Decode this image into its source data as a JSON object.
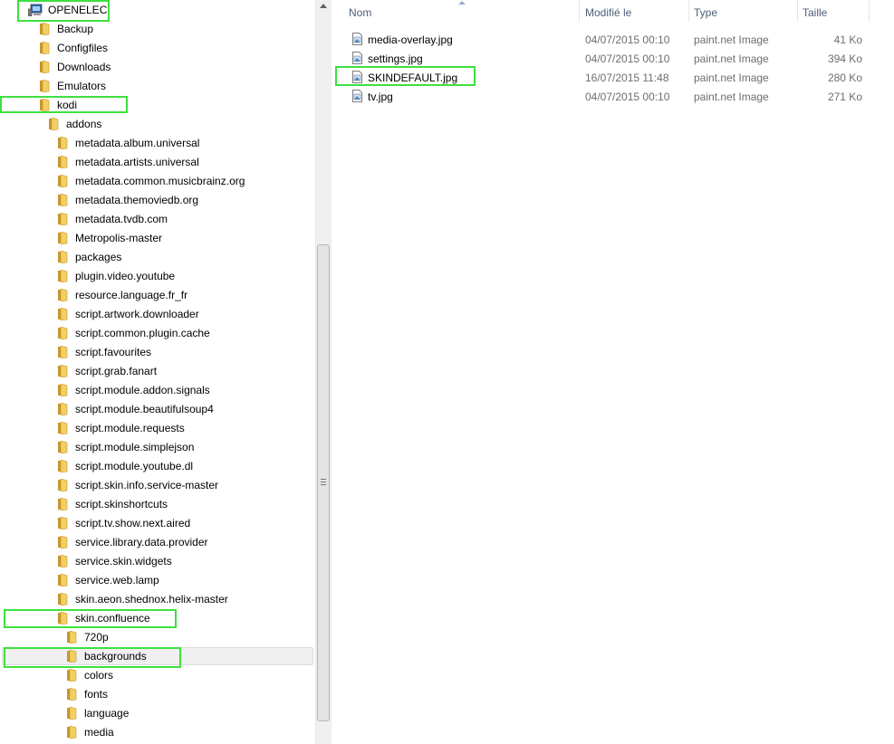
{
  "tree": {
    "items": [
      {
        "label": "OPENELEC",
        "icon": "computer-icon"
      },
      {
        "label": "Backup",
        "icon": "folder-icon"
      },
      {
        "label": "Configfiles",
        "icon": "folder-icon"
      },
      {
        "label": "Downloads",
        "icon": "folder-icon"
      },
      {
        "label": "Emulators",
        "icon": "folder-icon"
      },
      {
        "label": "kodi",
        "icon": "folder-icon"
      },
      {
        "label": "addons",
        "icon": "folder-icon"
      },
      {
        "label": "metadata.album.universal",
        "icon": "folder-icon"
      },
      {
        "label": "metadata.artists.universal",
        "icon": "folder-icon"
      },
      {
        "label": "metadata.common.musicbrainz.org",
        "icon": "folder-icon"
      },
      {
        "label": "metadata.themoviedb.org",
        "icon": "folder-icon"
      },
      {
        "label": "metadata.tvdb.com",
        "icon": "folder-icon"
      },
      {
        "label": "Metropolis-master",
        "icon": "folder-icon"
      },
      {
        "label": "packages",
        "icon": "folder-icon"
      },
      {
        "label": "plugin.video.youtube",
        "icon": "folder-icon"
      },
      {
        "label": "resource.language.fr_fr",
        "icon": "folder-icon"
      },
      {
        "label": "script.artwork.downloader",
        "icon": "folder-icon"
      },
      {
        "label": "script.common.plugin.cache",
        "icon": "folder-icon"
      },
      {
        "label": "script.favourites",
        "icon": "folder-icon"
      },
      {
        "label": "script.grab.fanart",
        "icon": "folder-icon"
      },
      {
        "label": "script.module.addon.signals",
        "icon": "folder-icon"
      },
      {
        "label": "script.module.beautifulsoup4",
        "icon": "folder-icon"
      },
      {
        "label": "script.module.requests",
        "icon": "folder-icon"
      },
      {
        "label": "script.module.simplejson",
        "icon": "folder-icon"
      },
      {
        "label": "script.module.youtube.dl",
        "icon": "folder-icon"
      },
      {
        "label": "script.skin.info.service-master",
        "icon": "folder-icon"
      },
      {
        "label": "script.skinshortcuts",
        "icon": "folder-icon"
      },
      {
        "label": "script.tv.show.next.aired",
        "icon": "folder-icon"
      },
      {
        "label": "service.library.data.provider",
        "icon": "folder-icon"
      },
      {
        "label": "service.skin.widgets",
        "icon": "folder-icon"
      },
      {
        "label": "service.web.lamp",
        "icon": "folder-icon"
      },
      {
        "label": "skin.aeon.shednox.helix-master",
        "icon": "folder-icon"
      },
      {
        "label": "skin.confluence",
        "icon": "folder-icon"
      },
      {
        "label": "720p",
        "icon": "folder-icon"
      },
      {
        "label": "backgrounds",
        "icon": "folder-icon"
      },
      {
        "label": "colors",
        "icon": "folder-icon"
      },
      {
        "label": "fonts",
        "icon": "folder-icon"
      },
      {
        "label": "language",
        "icon": "folder-icon"
      },
      {
        "label": "media",
        "icon": "folder-icon"
      }
    ]
  },
  "columns": {
    "name": "Nom",
    "modified": "Modifié le",
    "type": "Type",
    "size": "Taille"
  },
  "files": [
    {
      "name": "media-overlay.jpg",
      "modified": "04/07/2015 00:10",
      "type": "paint.net Image",
      "size": "41 Ko"
    },
    {
      "name": "settings.jpg",
      "modified": "04/07/2015 00:10",
      "type": "paint.net Image",
      "size": "394 Ko"
    },
    {
      "name": "SKINDEFAULT.jpg",
      "modified": "16/07/2015 11:48",
      "type": "paint.net Image",
      "size": "280 Ko"
    },
    {
      "name": "tv.jpg",
      "modified": "04/07/2015 00:10",
      "type": "paint.net Image",
      "size": "271 Ko"
    }
  ],
  "colors": {
    "highlight": "#3ee03e",
    "folder": "#e8c25a",
    "header_text": "#4c607a"
  }
}
